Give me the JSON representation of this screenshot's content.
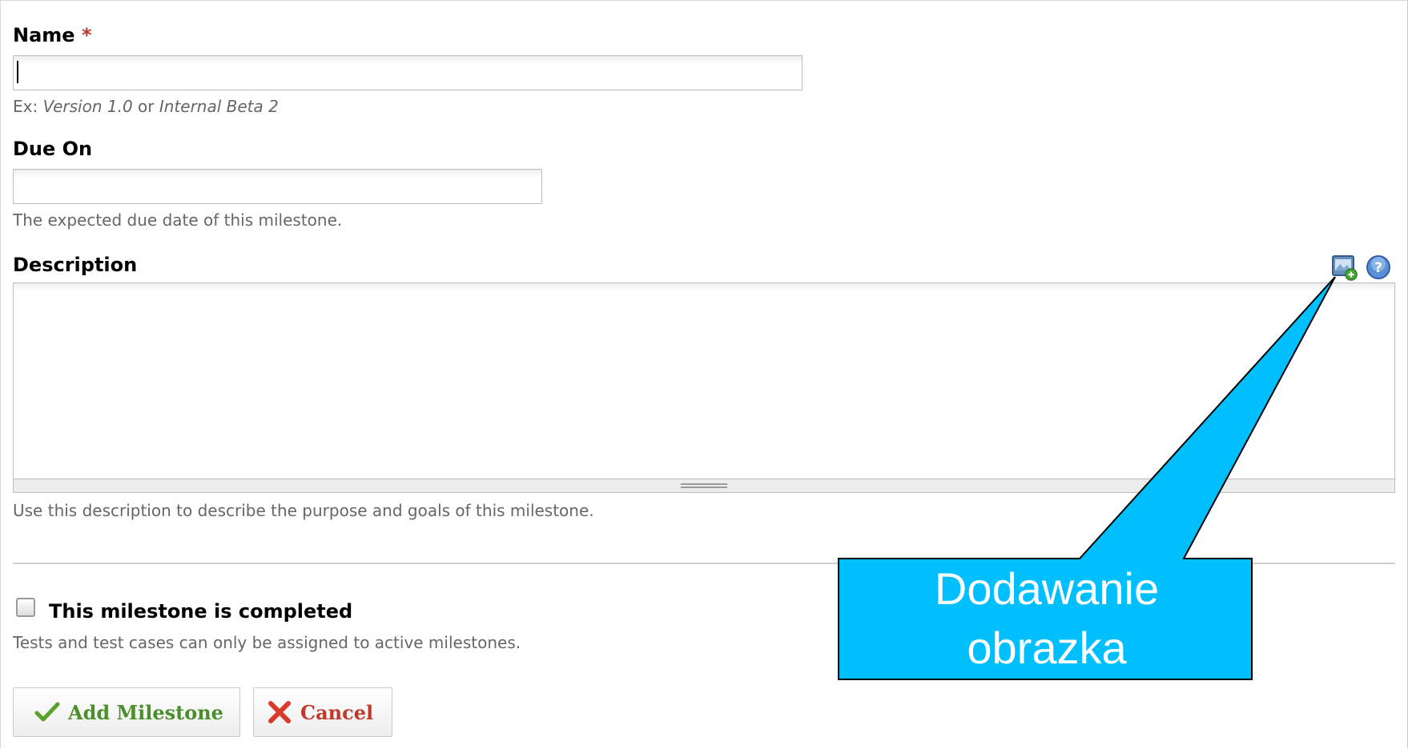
{
  "form": {
    "name": {
      "label": "Name",
      "required_mark": "*",
      "value": "",
      "hint_prefix": "Ex: ",
      "hint_example_1": "Version 1.0",
      "hint_or": " or ",
      "hint_example_2": "Internal Beta 2"
    },
    "due_on": {
      "label": "Due On",
      "value": "",
      "hint": "The expected due date of this milestone."
    },
    "description": {
      "label": "Description",
      "value": "",
      "hint": "Use this description to describe the purpose and goals of this milestone.",
      "toolbar_icons": [
        "add-image-icon",
        "help-icon"
      ]
    },
    "completed": {
      "label": "This milestone is completed",
      "checked": false,
      "hint": "Tests and test cases can only be assigned to active milestones."
    },
    "buttons": {
      "add_label": "Add Milestone",
      "cancel_label": "Cancel"
    }
  },
  "callout": {
    "line_1": "Dodawanie",
    "line_2": "obrazka",
    "fill_color": "#00bfff",
    "border_color": "#000000"
  },
  "colors": {
    "required": "#c0392b",
    "hint_text": "#666666",
    "add_button_text": "#4b8e2c",
    "cancel_button_text": "#c0392b"
  }
}
